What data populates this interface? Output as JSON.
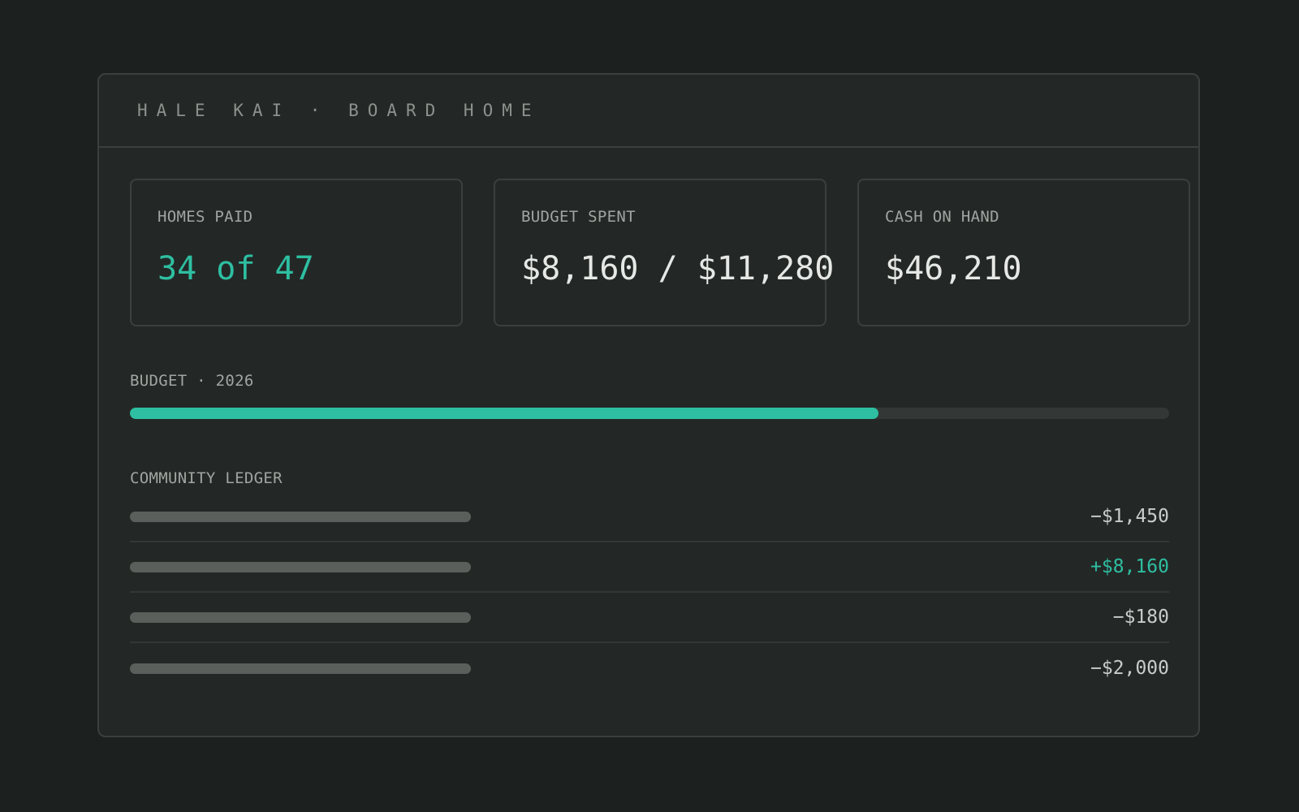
{
  "header": {
    "title": "HALE KAI · BOARD HOME"
  },
  "stats": [
    {
      "label": "HOMES PAID",
      "value": "34 of 47"
    },
    {
      "label": "BUDGET SPENT",
      "value": "$8,160 / $11,280"
    },
    {
      "label": "CASH ON HAND",
      "value": "$46,210"
    }
  ],
  "budget": {
    "label": "BUDGET · 2026",
    "spent": 8160,
    "total": 11280,
    "fill_fraction": 0.72
  },
  "ledger": {
    "label": "COMMUNITY LEDGER",
    "rows": [
      {
        "amount": "−$1,450",
        "type": "debit"
      },
      {
        "amount": "+$8,160",
        "type": "credit"
      },
      {
        "amount": "−$180",
        "type": "debit"
      },
      {
        "amount": "−$2,000",
        "type": "debit"
      }
    ]
  },
  "colors": {
    "accent": "#2ebfa2",
    "background": "#1c2120",
    "panel": "#232826"
  }
}
